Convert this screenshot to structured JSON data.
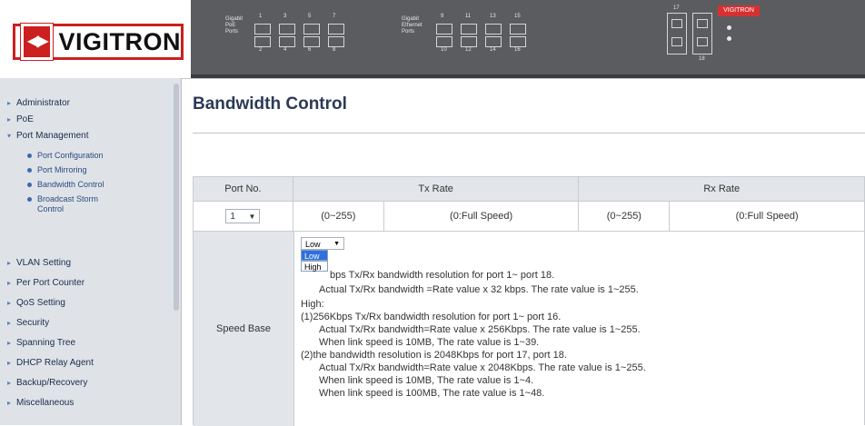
{
  "brand": {
    "name": "VIGITRON",
    "logo_color": "#cc1f1f"
  },
  "panel": {
    "group1_label": "Gigabit\nPoE\nPorts",
    "group2_label": "Gigabit\nEthernet\nPorts",
    "group1_top": [
      "1",
      "3",
      "5",
      "7"
    ],
    "group1_bottom": [
      "2",
      "4",
      "6",
      "8"
    ],
    "group2_top": [
      "9",
      "11",
      "13",
      "15"
    ],
    "group2_bottom": [
      "10",
      "12",
      "14",
      "16"
    ],
    "sfp_top": "17",
    "sfp_bottom": "18",
    "badge": "VIGITRON"
  },
  "sidebar": {
    "items": [
      {
        "label": "Administrator"
      },
      {
        "label": "PoE"
      },
      {
        "label": "Port Management"
      },
      {
        "label": "VLAN Setting"
      },
      {
        "label": "Per Port Counter"
      },
      {
        "label": "QoS Setting"
      },
      {
        "label": "Security"
      },
      {
        "label": "Spanning Tree"
      },
      {
        "label": "DHCP Relay Agent"
      },
      {
        "label": "Backup/Recovery"
      },
      {
        "label": "Miscellaneous"
      }
    ],
    "sub_items": [
      {
        "label": "Port Configuration"
      },
      {
        "label": "Port Mirroring"
      },
      {
        "label": "Bandwidth Control"
      },
      {
        "label": "Broadcast Storm Control"
      }
    ]
  },
  "page": {
    "title": "Bandwidth Control"
  },
  "table": {
    "headers": {
      "port_no": "Port No.",
      "tx_rate": "Tx Rate",
      "rx_rate": "Rx Rate"
    },
    "row": {
      "port_value": "1",
      "tx_range": "(0~255)",
      "tx_note": "(0:Full Speed)",
      "rx_range": "(0~255)",
      "rx_note": "(0:Full Speed)"
    }
  },
  "speed_base": {
    "label": "Speed Base",
    "selected": "Low",
    "options": [
      "Low",
      "High"
    ],
    "lines": [
      "  bps Tx/Rx bandwidth resolution for port 1~ port 18.",
      "Actual Tx/Rx bandwidth =Rate value x 32 kbps. The rate value is 1~255.",
      "High:",
      "(1)256Kbps Tx/Rx bandwidth resolution for port 1~ port 16.",
      "Actual Tx/Rx bandwidth=Rate value x 256Kbps. The rate value is 1~255.",
      "When link speed is 10MB, The rate value is 1~39.",
      "(2)the bandwidth resolution is 2048Kbps for port 17, port 18.",
      "Actual Tx/Rx bandwidth=Rate value x 2048Kbps. The rate value is 1~255.",
      "When link speed is 10MB, The rate value is 1~4.",
      "When link speed is 100MB, The rate value is 1~48."
    ]
  }
}
